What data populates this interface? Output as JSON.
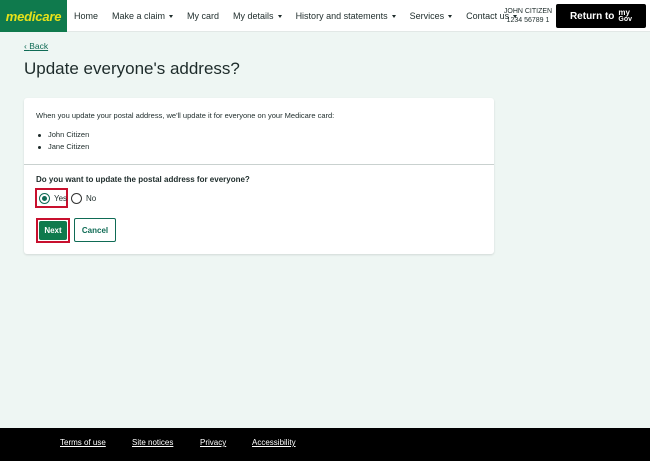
{
  "header": {
    "logo_text": "medicare",
    "nav": [
      {
        "label": "Home",
        "has_caret": false
      },
      {
        "label": "Make a claim",
        "has_caret": true
      },
      {
        "label": "My card",
        "has_caret": false
      },
      {
        "label": "My details",
        "has_caret": true
      },
      {
        "label": "History and statements",
        "has_caret": true
      },
      {
        "label": "Services",
        "has_caret": true
      },
      {
        "label": "Contact us",
        "has_caret": true
      }
    ],
    "user_name": "JOHN CITIZEN",
    "user_number": "1234 56789 1",
    "return_label": "Return to",
    "mygov_top": "my",
    "mygov_bottom": "Gov"
  },
  "main": {
    "back_label": "Back",
    "title": "Update everyone's address?",
    "info_text": "When you update your postal address, we'll update it for everyone on your Medicare card:",
    "names": [
      "John Citizen",
      "Jane Citizen"
    ],
    "question": "Do you want to update the postal address for everyone?",
    "options": {
      "yes": "Yes",
      "no": "No",
      "selected": "yes"
    },
    "next_label": "Next",
    "cancel_label": "Cancel"
  },
  "footer": {
    "links": [
      "Terms of use",
      "Site notices",
      "Privacy",
      "Accessibility"
    ]
  },
  "colors": {
    "brand_green": "#0f7a4d",
    "logo_yellow": "#e7e21a",
    "highlight_red": "#c8102e",
    "page_bg": "#eef6f3"
  }
}
